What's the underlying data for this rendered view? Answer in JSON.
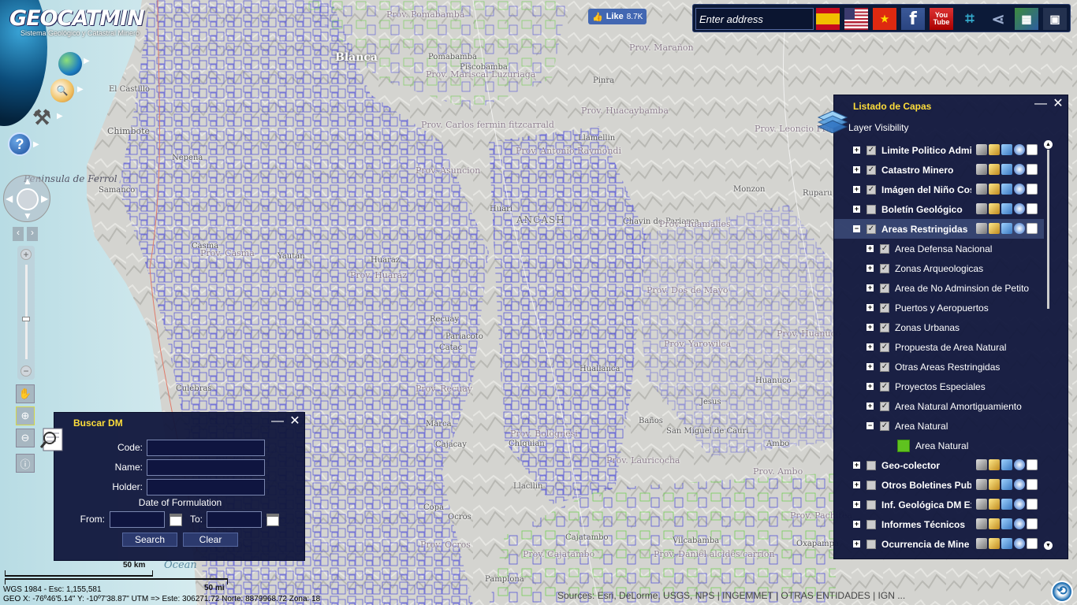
{
  "app": {
    "title": "GEOCATMIN",
    "subtitle": "Sistema Geológico y Catastral Minero"
  },
  "social": {
    "like_label": "Like",
    "like_count": "8.7K"
  },
  "topbar": {
    "address_placeholder": "Enter address",
    "youtube_top": "You",
    "youtube_bottom": "Tube",
    "facebook_letter": "f"
  },
  "layers_panel": {
    "title": "Listado de Capas",
    "visibility_label": "Layer Visibility",
    "layers": [
      {
        "name": "Limite Politico Admi",
        "expanded": false,
        "checked": true,
        "tools": true
      },
      {
        "name": "Catastro Minero",
        "expanded": false,
        "checked": true,
        "tools": true
      },
      {
        "name": "Imágen del Niño Cos",
        "expanded": false,
        "checked": true,
        "tools": true
      },
      {
        "name": "Boletín Geológico",
        "expanded": false,
        "checked": false,
        "tools": true
      },
      {
        "name": "Areas Restringidas",
        "expanded": true,
        "checked": true,
        "tools": true,
        "selected": true
      }
    ],
    "sublayers": [
      {
        "name": "Area Defensa Nacional",
        "checked": true
      },
      {
        "name": "Zonas Arqueologicas",
        "checked": true
      },
      {
        "name": "Area de No Adminsion de Petito",
        "checked": true
      },
      {
        "name": "Puertos y Aeropuertos",
        "checked": true
      },
      {
        "name": "Zonas Urbanas",
        "checked": true
      },
      {
        "name": "Propuesta de Area Natural",
        "checked": true
      },
      {
        "name": "Otras Areas Restringidas",
        "checked": true
      },
      {
        "name": "Proyectos Especiales",
        "checked": true
      },
      {
        "name": "Area Natural Amortiguamiento",
        "checked": true
      },
      {
        "name": "Area Natural",
        "checked": true,
        "expanded": true
      }
    ],
    "legend_item": "Area Natural",
    "layers_after": [
      {
        "name": "Geo-colector",
        "checked": false
      },
      {
        "name": "Otros Boletines Pub",
        "checked": false
      },
      {
        "name": "Inf. Geológica DM Ex",
        "checked": false
      },
      {
        "name": "Informes Técnicos",
        "checked": false
      },
      {
        "name": "Ocurrencia de Mine",
        "checked": false
      }
    ]
  },
  "search_panel": {
    "title": "Buscar DM",
    "code_label": "Code:",
    "name_label": "Name:",
    "holder_label": "Holder:",
    "date_label": "Date of Formulation",
    "from_label": "From:",
    "to_label": "To:",
    "code_value": "",
    "name_value": "",
    "holder_value": "",
    "from_value": "",
    "to_value": "",
    "search_button": "Search",
    "clear_button": "Clear"
  },
  "scale": {
    "km_label": "50 km",
    "mi_label": "50 mi"
  },
  "status": {
    "line1": "WGS 1984 - Esc: 1,155,581",
    "line2": "GEO X: -76º46'5.14\"  Y: -10º7'38.87\"    UTM => Este: 306271.72  Norte: 8879968.72  Zona: 18"
  },
  "attribution": "Sources: Esri, DeLorme, USGS, NPS | INGEMMET | OTRAS ENTIDADES | IGN ...",
  "map_labels": {
    "blanca": "Blanca",
    "el_castillo": "El Castillo",
    "chimbote": "Chimbote",
    "peninsula": "Peninsula de Ferrol",
    "samanco": "Samanco",
    "nepena": "Nepeña",
    "casma": "Casma",
    "culebras": "Culebras",
    "ocean": "Ocean",
    "huari": "Huari",
    "ancash": "ANCASH",
    "pomabamba": "Pomabamba",
    "piscobamba": "Piscobamba",
    "pinra": "Pinra",
    "llamellin": "Llamellin",
    "chavin": "Chavin de Pariarca",
    "monzon": "Monzon",
    "ruparu": "Ruparu",
    "huayucachi": "Huanuco",
    "recuay": "Recuay",
    "catac": "Catac",
    "huaraz": "Huaraz",
    "yaullan": "Yaután",
    "pariacoto": "Pariacoto",
    "chiquian": "Chiquian",
    "marca": "Marca",
    "cajacay": "Cajacay",
    "copa": "Copa",
    "ocros": "Ocros",
    "llacllin": "Llacllin",
    "cajatambo": "Cajatambo",
    "pamplona": "Pamplona",
    "vilcabamba": "Vilcabamba",
    "ambo": "Ambo",
    "huallanca": "Huallanca",
    "baños": "Baños",
    "san_miguel": "San Miguel de Cauri",
    "jesus": "Jesus",
    "prov_marañon": "Prov. Marañon",
    "prov_fitzcarrald": "Prov. Carlos fermin fitzcarrald",
    "prov_asuncion": "Prov. Asuncion",
    "prov_huacaybamba": "Prov. Huacaybamba",
    "prov_leoncio": "Prov. Leoncio Prado",
    "prov_huamalies": "Prov. Huamalies",
    "prov_dos_de_mayo": "Prov. Dos de Mayo",
    "prov_yarowilca": "Prov. Yarowilca",
    "prov_huanuco": "Prov. Huanuco",
    "prov_lauricocha": "Prov. Lauricocha",
    "prov_bolognesi": "Prov. Bolognesi",
    "prov_recuay": "Prov. Recuay",
    "prov_huaraz": "Prov. Huaraz",
    "prov_casma": "Prov. Casma",
    "prov_pomabamba": "Prov. Pomabamba",
    "prov_mariscal": "Prov. Mariscal Luzuriaga",
    "prov_antonio": "Prov. Antonio Raymondi",
    "prov_ocros": "Prov. Ocros",
    "prov_cajatambo": "Prov. Cajatambo",
    "prov_daniel": "Prov. Daniel alcides carrion",
    "prov_ambo": "Prov. Ambo",
    "prov_pachitea": "Prov. Pachitea",
    "prov_oxapampa": "Oxapampa"
  }
}
